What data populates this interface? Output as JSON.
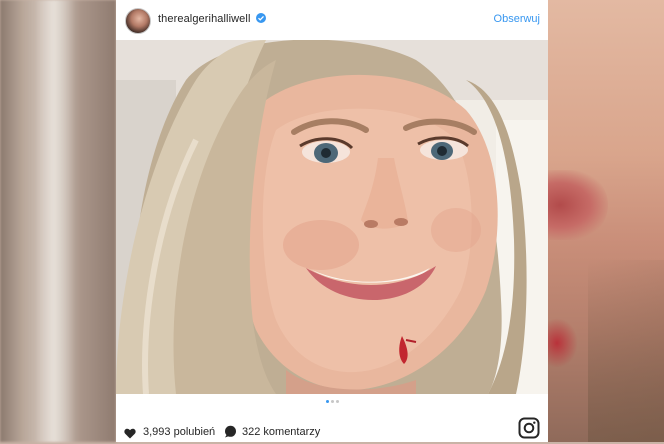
{
  "post": {
    "username": "therealgerihalliwell",
    "follow_label": "Obserwuj",
    "likes_label": "3,993 polubień",
    "comments_label": "322 komentarzy",
    "carousel_total": 3,
    "carousel_active": 1
  },
  "icons": {
    "verified": "verified-badge-icon",
    "heart": "heart-icon",
    "comment": "comment-icon",
    "brand": "instagram-icon"
  },
  "colors": {
    "link": "#3897f0",
    "text": "#262626",
    "dot_inactive": "#c7c7c7"
  }
}
